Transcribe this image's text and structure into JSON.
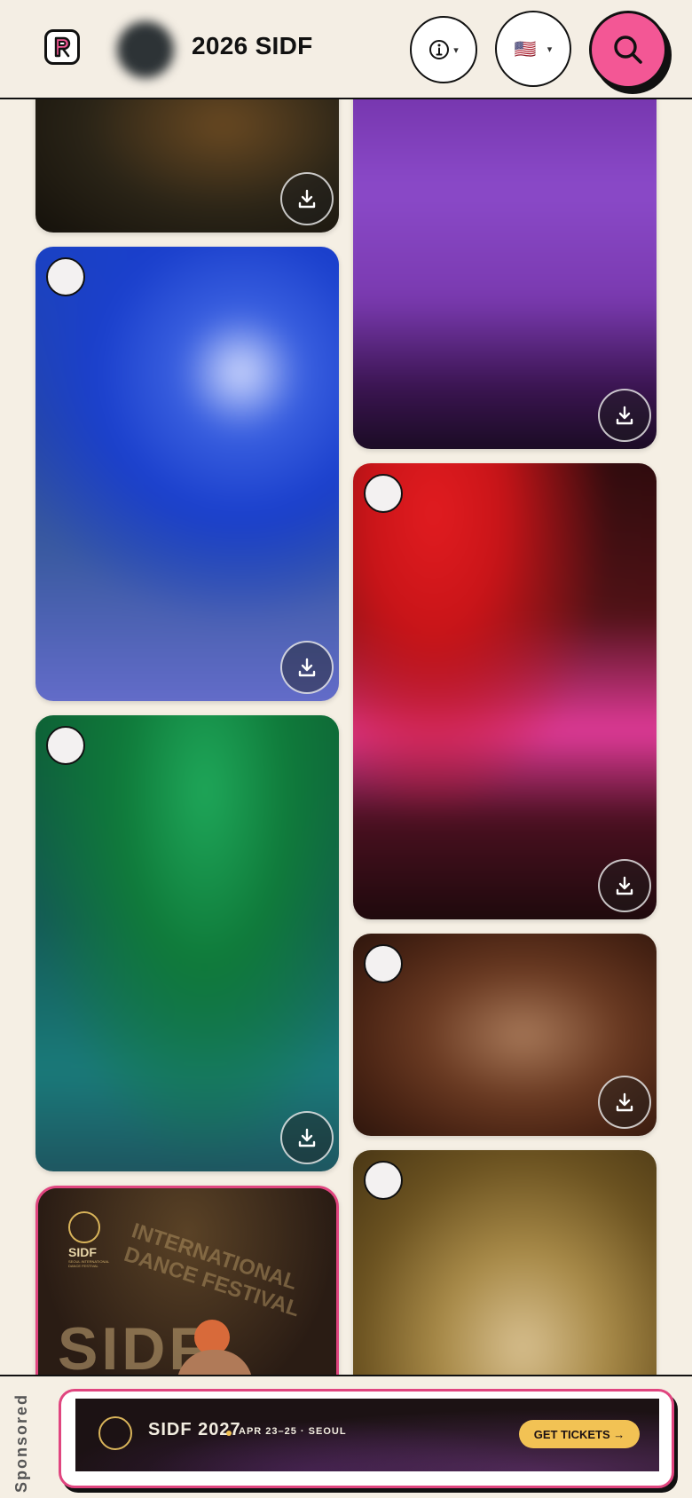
{
  "header": {
    "title": "2026 SIDF",
    "language_flag": "🇺🇸",
    "brand_color": "#f35795"
  },
  "gallery": {
    "left_column": [
      {
        "kind": "photo",
        "palette": [
          "#2a2417",
          "#6b4a22",
          "#0c0906"
        ]
      },
      {
        "kind": "photo",
        "palette": [
          "#1a3fcc",
          "#3a5aa0",
          "#a9b4e6"
        ]
      },
      {
        "kind": "photo",
        "palette": [
          "#0f7a3a",
          "#145a56",
          "#1f4d5a"
        ]
      },
      {
        "kind": "featured",
        "logo_text": "SIDF",
        "logo_subtext": "SEOUL INTERNATIONAL DANCE FESTIVAL",
        "backdrop_text": "SIDF",
        "arc_text": "INTERNATIONAL DANCE FESTIVAL"
      }
    ],
    "right_column": [
      {
        "kind": "photo",
        "palette": [
          "#6a2a9e",
          "#8b4ac9",
          "#0e0812"
        ]
      },
      {
        "kind": "photo",
        "palette": [
          "#c81418",
          "#e23b9a",
          "#140808"
        ]
      },
      {
        "kind": "photo",
        "palette": [
          "#4a2414",
          "#a97a5a",
          "#1a0c08"
        ]
      },
      {
        "kind": "photo",
        "palette": [
          "#6b5220",
          "#a88a48",
          "#3a2a10"
        ]
      }
    ]
  },
  "ad": {
    "sponsored_label": "Sponsored",
    "event_name": "SIDF 2027",
    "event_when": "APR 23–25 · SEOUL",
    "cta_label": "GET TICKETS →",
    "cta_color": "#f2c254",
    "accent_color": "#e0457f"
  }
}
